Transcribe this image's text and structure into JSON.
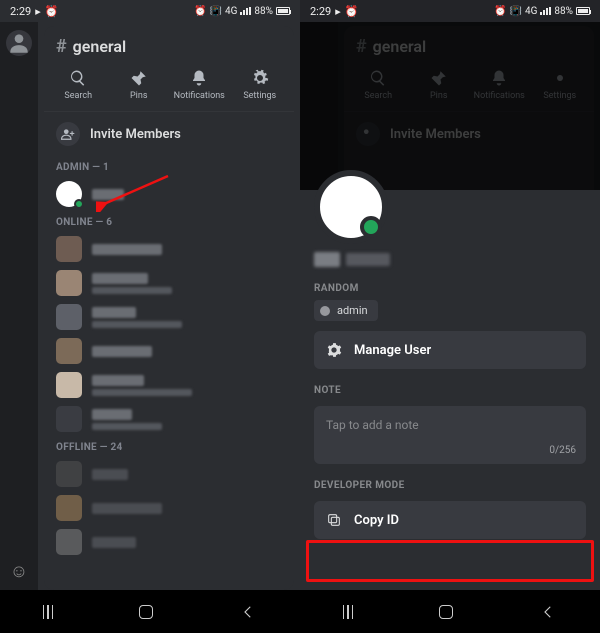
{
  "status": {
    "time": "2:29",
    "battery_pct": "88%",
    "net": "4G"
  },
  "left": {
    "channel_name": "general",
    "actions": {
      "search": "Search",
      "pins": "Pins",
      "notifications": "Notifications",
      "settings": "Settings"
    },
    "invite_label": "Invite Members",
    "sections": {
      "admin": {
        "label": "ADMIN — 1",
        "count": 1
      },
      "online": {
        "label": "ONLINE — 6",
        "count": 6
      },
      "offline": {
        "label": "OFFLINE — 24",
        "count": 24
      }
    }
  },
  "right": {
    "server_role_section": "RANDOM",
    "role_name": "admin",
    "manage_user": "Manage User",
    "note_section": "NOTE",
    "note_placeholder": "Tap to add a note",
    "note_counter": "0/256",
    "dev_section": "DEVELOPER MODE",
    "copy_id": "Copy ID"
  }
}
